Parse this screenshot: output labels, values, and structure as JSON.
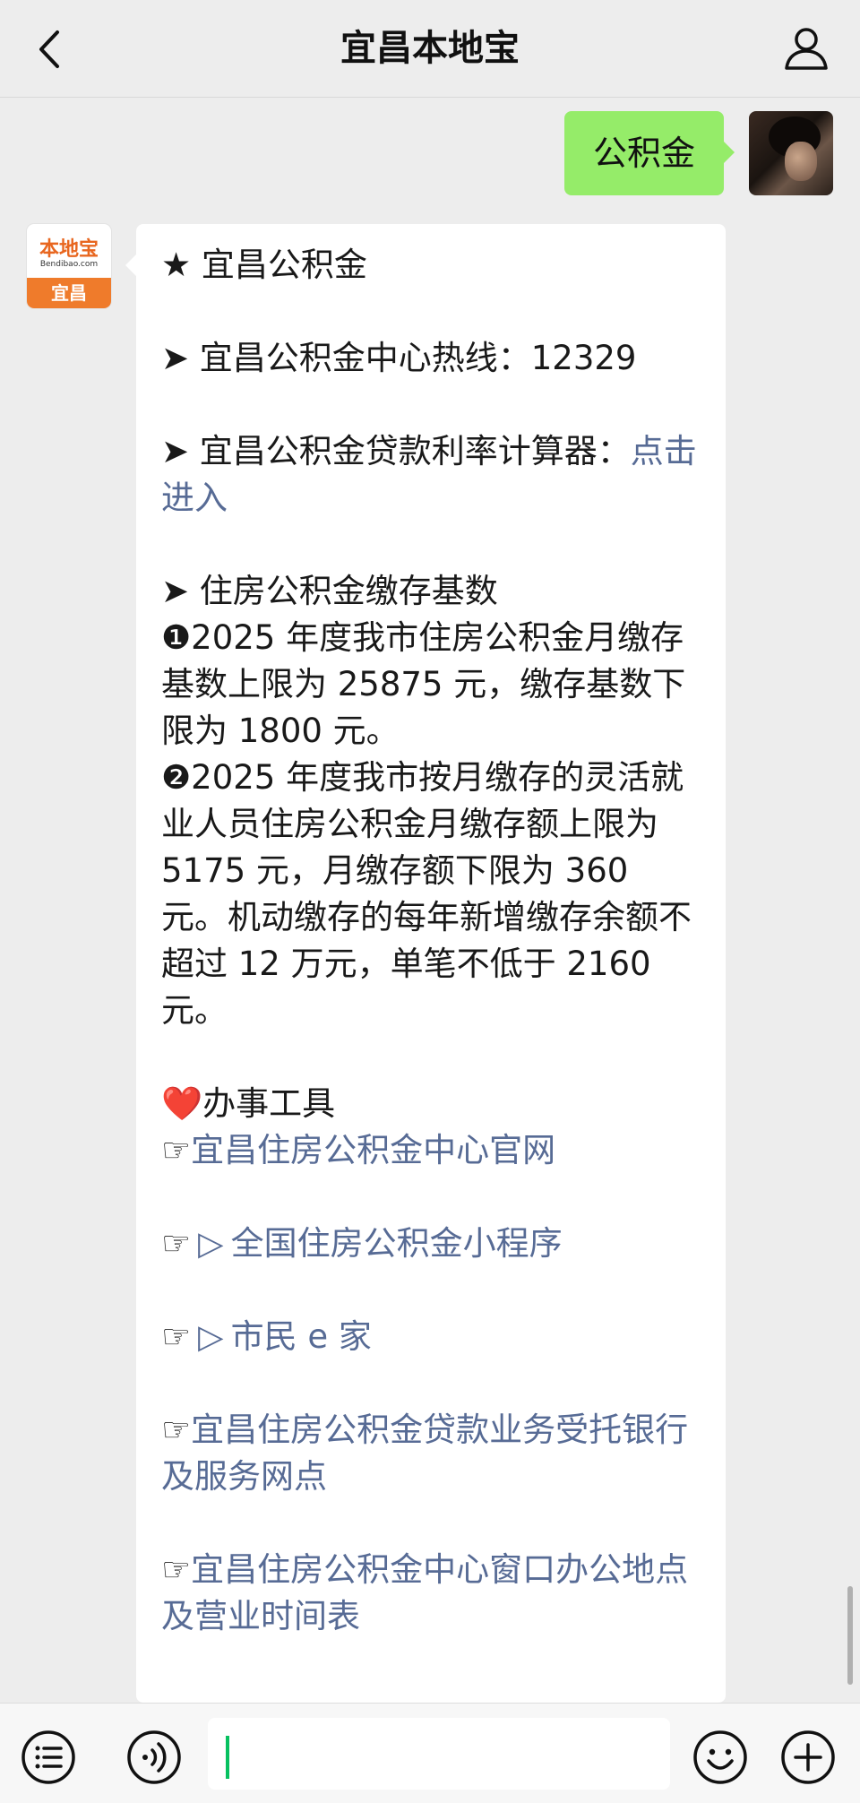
{
  "header": {
    "title": "宜昌本地宝",
    "back_icon": "chevron-left-icon",
    "profile_icon": "person-icon"
  },
  "user_message": {
    "text": "公积金"
  },
  "bot_avatar": {
    "logo_top": "本地宝",
    "logo_url": "Bendibao.com",
    "logo_city": "宜昌"
  },
  "bot_message": {
    "title": "★ 宜昌公积金",
    "hotline_label": "➤ 宜昌公积金中心热线：12329",
    "calculator_label": "➤ 宜昌公积金贷款利率计算器：",
    "calculator_link": "点击进入",
    "base_heading": "➤ 住房公积金缴存基数",
    "item1": "❶2025 年度我市住房公积金月缴存基数上限为 25875 元，缴存基数下限为 1800 元。",
    "item2": "❷2025 年度我市按月缴存的灵活就业人员住房公积金月缴存额上限为 5175 元，月缴存额下限为 360 元。机动缴存的每年新增缴存余额不超过 12 万元，单笔不低于 2160 元。",
    "tools_heading": "❤️办事工具",
    "tools": [
      {
        "hand": "☞",
        "play": "",
        "label": "宜昌住房公积金中心官网"
      },
      {
        "hand": "☞",
        "play": "▷",
        "label": "全国住房公积金小程序"
      },
      {
        "hand": "☞",
        "play": "▷",
        "label": "市民 e 家"
      },
      {
        "hand": "☞",
        "play": "",
        "label": "宜昌住房公积金贷款业务受托银行及服务网点"
      },
      {
        "hand": "☞",
        "play": "",
        "label": "宜昌住房公积金中心窗口办公地点及营业时间表"
      }
    ]
  },
  "bottom_bar": {
    "menu_icon": "menu-list-icon",
    "voice_icon": "voice-icon",
    "input_value": "",
    "emoji_icon": "emoji-icon",
    "plus_icon": "plus-icon"
  },
  "colors": {
    "background": "#ededed",
    "user_bubble": "#95ec69",
    "bot_bubble": "#ffffff",
    "link": "#576b95",
    "cursor": "#07c160"
  }
}
